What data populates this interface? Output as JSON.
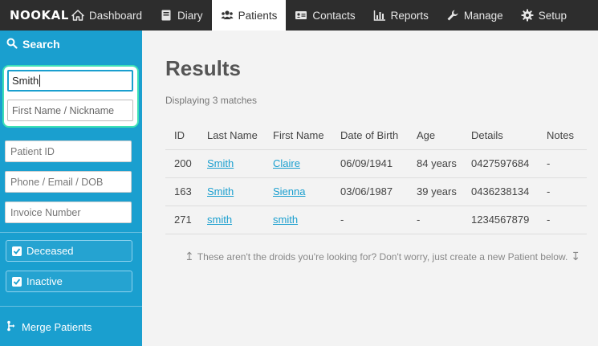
{
  "brand": "NOOKAL",
  "nav": [
    {
      "label": "Dashboard",
      "icon": "home-icon"
    },
    {
      "label": "Diary",
      "icon": "book-icon"
    },
    {
      "label": "Patients",
      "icon": "users-icon",
      "active": true
    },
    {
      "label": "Contacts",
      "icon": "address-card-icon"
    },
    {
      "label": "Reports",
      "icon": "bar-chart-icon"
    },
    {
      "label": "Manage",
      "icon": "wrench-icon"
    },
    {
      "label": "Setup",
      "icon": "gear-icon"
    }
  ],
  "sidebar": {
    "header": "Search",
    "last_name_value": "Smith",
    "first_name_placeholder": "First Name / Nickname",
    "patient_id_placeholder": "Patient ID",
    "contact_placeholder": "Phone / Email / DOB",
    "invoice_placeholder": "Invoice Number",
    "deceased_label": "Deceased",
    "inactive_label": "Inactive",
    "merge_label": "Merge Patients"
  },
  "results": {
    "title": "Results",
    "subtitle": "Displaying 3 matches",
    "columns": [
      "ID",
      "Last Name",
      "First Name",
      "Date of Birth",
      "Age",
      "Details",
      "Notes"
    ],
    "rows": [
      {
        "id": "200",
        "last": "Smith",
        "first": "Claire",
        "dob": "06/09/1941",
        "age": "84 years",
        "details": "0427597684",
        "notes": "-"
      },
      {
        "id": "163",
        "last": "Smith",
        "first": "Sienna",
        "dob": "03/06/1987",
        "age": "39 years",
        "details": "0436238134",
        "notes": "-"
      },
      {
        "id": "271",
        "last": "smith",
        "first": "smith",
        "dob": "-",
        "age": "-",
        "details": "1234567879",
        "notes": "-"
      }
    ],
    "hint": "These aren't the droids you're looking for? Don't worry, just create a new Patient below."
  },
  "colors": {
    "sidebar": "#1a9fcf",
    "topbar": "#2d2d2d",
    "focus": "#3de0b6",
    "link": "#1a9fcf"
  }
}
